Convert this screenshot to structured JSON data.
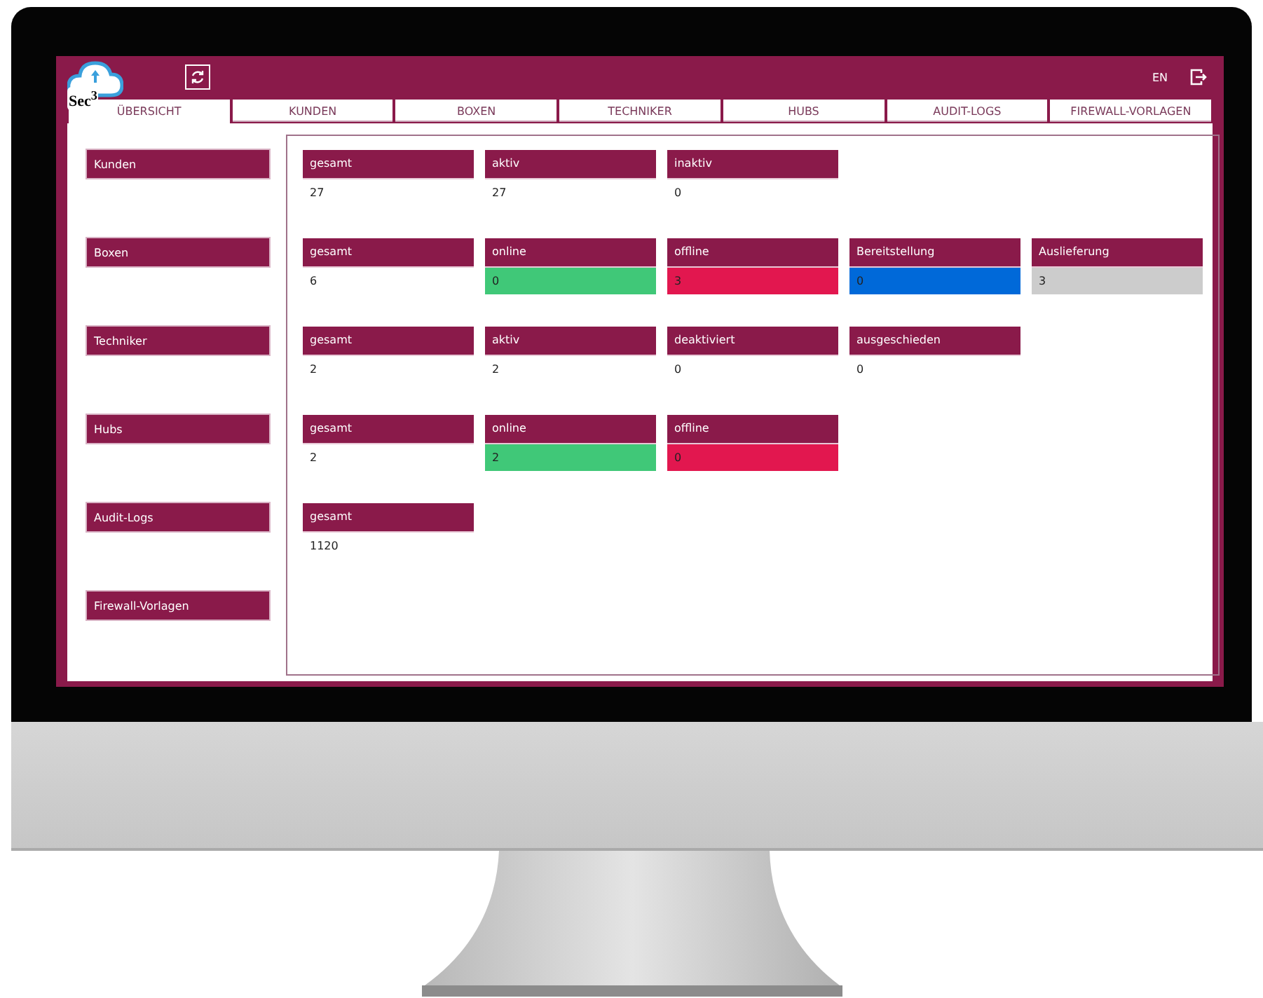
{
  "header": {
    "logo": "Sec$^{3}$",
    "language": "EN"
  },
  "tabs": [
    {
      "label": "ÜBERSICHT",
      "selected": true
    },
    {
      "label": "KUNDEN",
      "selected": false
    },
    {
      "label": "BOXEN",
      "selected": false
    },
    {
      "label": "TECHNIKER",
      "selected": false
    },
    {
      "label": "HUBS",
      "selected": false
    },
    {
      "label": "AUDIT-LOGS",
      "selected": false
    },
    {
      "label": "FIREWALL-VORLAGEN",
      "selected": false
    }
  ],
  "sections": [
    {
      "label": "Kunden",
      "stats": [
        {
          "label": "gesamt",
          "value": "27"
        },
        {
          "label": "aktiv",
          "value": "27"
        },
        {
          "label": "inaktiv",
          "value": "0"
        }
      ]
    },
    {
      "label": "Boxen",
      "stats": [
        {
          "label": "gesamt",
          "value": "6"
        },
        {
          "label": "online",
          "value": "0",
          "color": "#40c878"
        },
        {
          "label": "offline",
          "value": "3",
          "color": "#e2174f"
        },
        {
          "label": "Bereitstellung",
          "value": "0",
          "color": "#0069d9"
        },
        {
          "label": "Auslieferung",
          "value": "3",
          "color": "#cccccc"
        }
      ]
    },
    {
      "label": "Techniker",
      "stats": [
        {
          "label": "gesamt",
          "value": "2"
        },
        {
          "label": "aktiv",
          "value": "2"
        },
        {
          "label": "deaktiviert",
          "value": "0"
        },
        {
          "label": "ausgeschieden",
          "value": "0"
        }
      ]
    },
    {
      "label": "Hubs",
      "stats": [
        {
          "label": "gesamt",
          "value": "2"
        },
        {
          "label": "online",
          "value": "2",
          "color": "#40c878"
        },
        {
          "label": "offline",
          "value": "0",
          "color": "#e2174f"
        }
      ]
    },
    {
      "label": "Audit-Logs",
      "stats": [
        {
          "label": "gesamt",
          "value": "1120"
        }
      ]
    },
    {
      "label": "Firewall-Vorlagen"
    }
  ]
}
